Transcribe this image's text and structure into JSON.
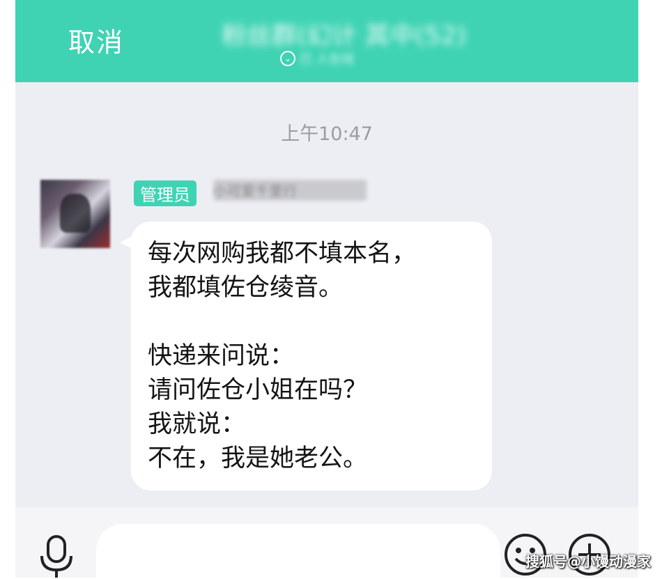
{
  "header": {
    "cancel_label": "取消",
    "group_title": "粉丝群(幻计 其中(52)",
    "group_subtitle": "已 人在线"
  },
  "chat": {
    "timestamp": "上午10:47",
    "messages": [
      {
        "role_badge": "管理员",
        "sender_name": "小可爱千里行",
        "text": "每次网购我都不填本名，\n我都填佐仓绫音。\n\n快递来问说：\n请问佐仓小姐在吗？\n我就说：\n不在，我是她老公。"
      }
    ]
  },
  "input_bar": {
    "placeholder": "",
    "icons": [
      "microphone-icon",
      "emoji-icon",
      "plus-icon"
    ]
  },
  "watermark": "搜狐号@小馒动漫家",
  "colors": {
    "accent": "#3fd3b4",
    "background": "#edeef3",
    "bubble": "#ffffff"
  }
}
